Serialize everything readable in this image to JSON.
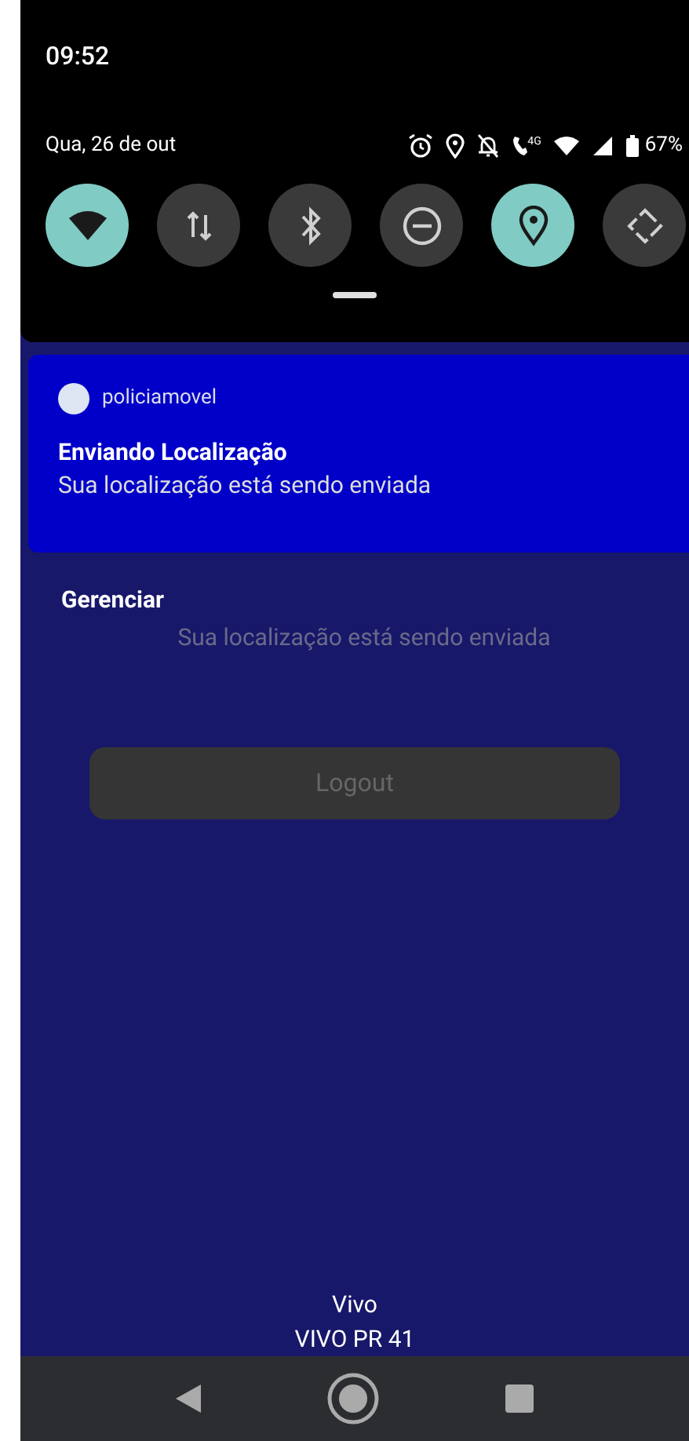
{
  "status_bar": {
    "time": "09:52"
  },
  "quick_settings": {
    "date": "Qua, 26 de out",
    "network_label": "4G",
    "battery": "67%",
    "tiles": [
      {
        "kind": "wifi",
        "on": true
      },
      {
        "kind": "data",
        "on": false
      },
      {
        "kind": "bluetooth",
        "on": false
      },
      {
        "kind": "dnd",
        "on": false
      },
      {
        "kind": "location",
        "on": true
      },
      {
        "kind": "rotate",
        "on": false
      }
    ]
  },
  "notification": {
    "app": "policiamovel",
    "title": "Enviando Localização",
    "text": "Sua localização está sendo enviada"
  },
  "manage_label": "Gerenciar",
  "app_screen": {
    "status_text": "Sua localização está sendo enviada",
    "logout_button": "Logout",
    "carrier": "Vivo",
    "carrier_detail": "VIVO PR 41"
  }
}
